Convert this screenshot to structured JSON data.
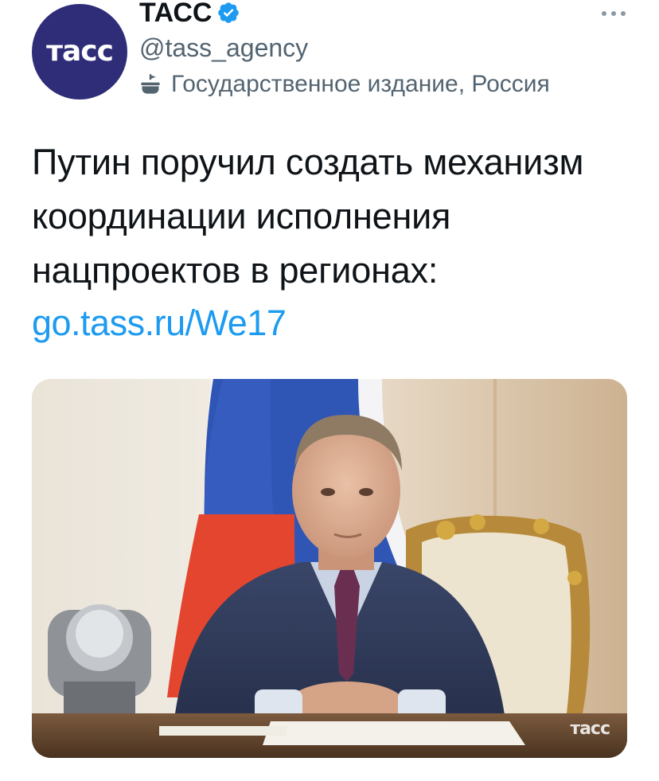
{
  "author": {
    "avatar_logo": "тасс",
    "display_name": "ТАСС",
    "handle": "@tass_agency",
    "label": "Государственное издание, Россия",
    "verified_icon": "verified-badge-icon",
    "label_icon": "government-building-icon"
  },
  "tweet": {
    "text_lines": [
      "Путин поручил создать механизм",
      "координации исполнения",
      "нацпроектов в регионах:"
    ],
    "link": "go.tass.ru/We17"
  },
  "media": {
    "watermark": "тасс"
  },
  "colors": {
    "link": "#1d9bf0",
    "verified": "#1d9bf0",
    "secondary_text": "#536471",
    "avatar_bg": "#2f2d78"
  },
  "more_icon": "more-horizontal-icon"
}
